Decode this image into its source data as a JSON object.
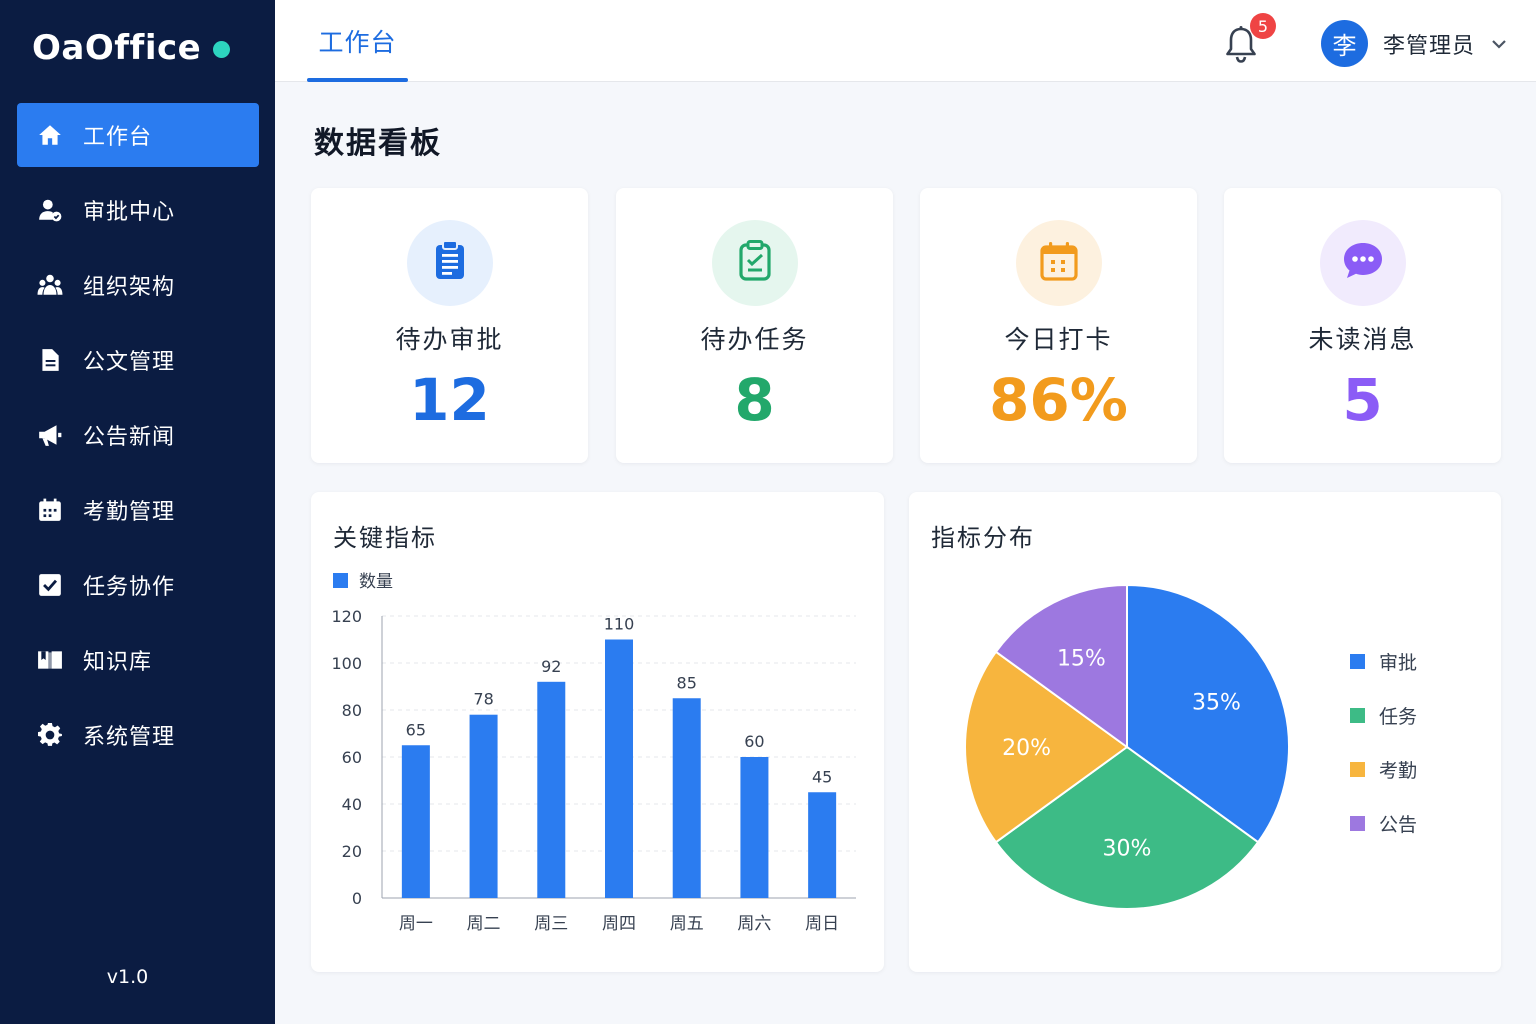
{
  "app": {
    "name": "OaOffice",
    "version": "v1.0"
  },
  "sidebar": {
    "items": [
      {
        "label": "工作台",
        "icon": "home-icon",
        "active": true
      },
      {
        "label": "审批中心",
        "icon": "user-approval-icon",
        "active": false
      },
      {
        "label": "组织架构",
        "icon": "team-icon",
        "active": false
      },
      {
        "label": "公文管理",
        "icon": "document-icon",
        "active": false
      },
      {
        "label": "公告新闻",
        "icon": "megaphone-icon",
        "active": false
      },
      {
        "label": "考勤管理",
        "icon": "calendar-icon",
        "active": false
      },
      {
        "label": "任务协作",
        "icon": "checkbox-icon",
        "active": false
      },
      {
        "label": "知识库",
        "icon": "book-icon",
        "active": false
      },
      {
        "label": "系统管理",
        "icon": "gear-icon",
        "active": false
      }
    ]
  },
  "header": {
    "tab": "工作台",
    "notification_count": "5",
    "user": {
      "avatar_text": "李",
      "name": "李管理员"
    }
  },
  "page": {
    "title": "数据看板"
  },
  "stats": [
    {
      "label": "待办审批",
      "value": "12",
      "color": "#1d6ce0",
      "bg": "#e6f0fd",
      "icon": "clipboard-list-icon"
    },
    {
      "label": "待办任务",
      "value": "8",
      "color": "#22a86b",
      "bg": "#e5f6ee",
      "icon": "clipboard-check-icon"
    },
    {
      "label": "今日打卡",
      "value": "86%",
      "color": "#f29b1d",
      "bg": "#fdf1df",
      "icon": "calendar-check-icon"
    },
    {
      "label": "未读消息",
      "value": "5",
      "color": "#8b5cf6",
      "bg": "#f1ebfd",
      "icon": "chat-bubble-icon"
    }
  ],
  "chart_data": [
    {
      "type": "bar",
      "title": "关键指标",
      "legend": [
        "数量"
      ],
      "categories": [
        "周一",
        "周二",
        "周三",
        "周四",
        "周五",
        "周六",
        "周日"
      ],
      "series": [
        {
          "name": "数量",
          "values": [
            65,
            78,
            92,
            110,
            85,
            60,
            45
          ],
          "color": "#2b7cf0"
        }
      ],
      "ylim": [
        0,
        120
      ],
      "yticks": [
        0,
        20,
        40,
        60,
        80,
        100,
        120
      ],
      "grid": true,
      "legend_position": "top-left"
    },
    {
      "type": "pie",
      "title": "指标分布",
      "slices": [
        {
          "name": "审批",
          "value": 35,
          "label": "35%",
          "color": "#2b7cf0"
        },
        {
          "name": "任务",
          "value": 30,
          "label": "30%",
          "color": "#3dbb86"
        },
        {
          "name": "考勤",
          "value": 20,
          "label": "20%",
          "color": "#f7b53e"
        },
        {
          "name": "公告",
          "value": 15,
          "label": "15%",
          "color": "#9d78e0"
        }
      ],
      "legend_position": "right"
    }
  ]
}
